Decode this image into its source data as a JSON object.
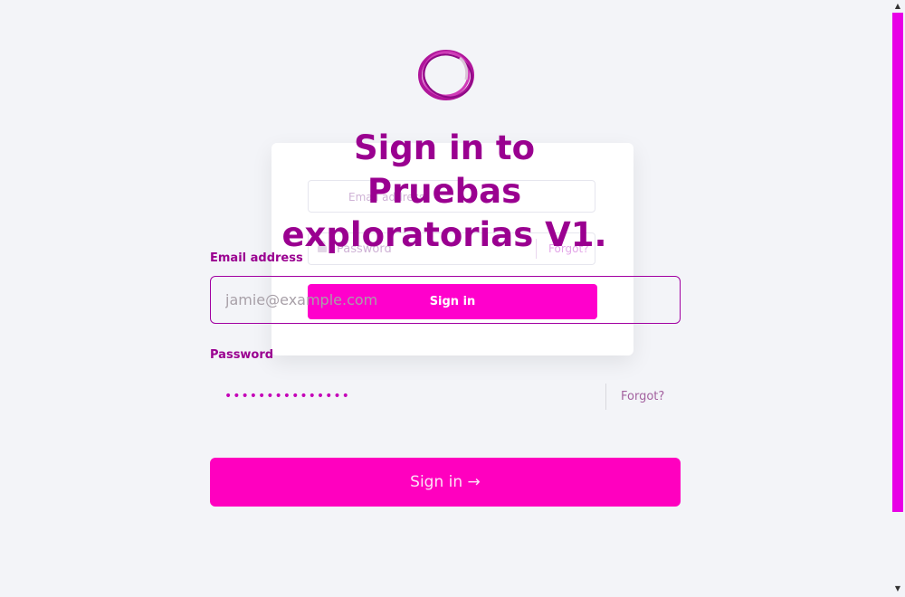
{
  "logo": {
    "icon": "ring-logo-icon",
    "color": "#c2189b"
  },
  "title": "Sign in to Pruebas exploratorias V1.",
  "ghost_form": {
    "email_placeholder": "Email address",
    "password_placeholder": "Password",
    "forgot_label": "Forgot?",
    "signin_label": "Sign in"
  },
  "form": {
    "email_label": "Email address",
    "email_placeholder": "jamie@example.com",
    "password_label": "Password",
    "password_value": "•••••••••••••••",
    "forgot_label": "Forgot?",
    "signin_label": "Sign in →"
  },
  "colors": {
    "accent": "#ff00bf",
    "title": "#9a0090",
    "background": "#f3f4f8"
  }
}
